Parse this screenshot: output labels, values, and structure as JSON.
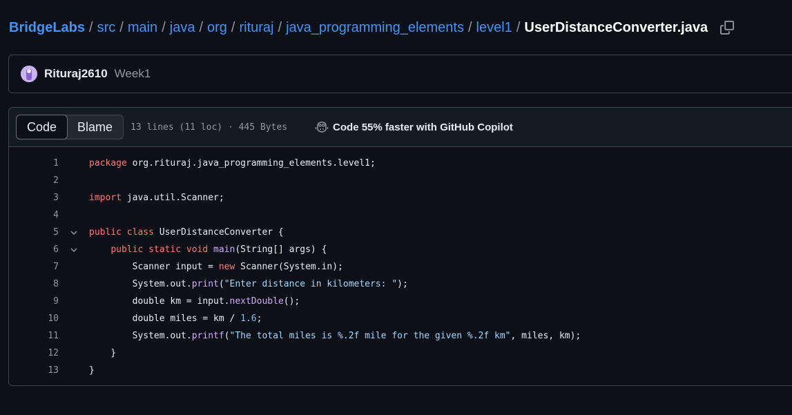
{
  "breadcrumb": {
    "repo": "BridgeLabs",
    "path": [
      "src",
      "main",
      "java",
      "org",
      "rituraj",
      "java_programming_elements",
      "level1"
    ],
    "separator": "/",
    "file": "UserDistanceConverter.java"
  },
  "commit": {
    "author": "Rituraj2610",
    "message": "Week1"
  },
  "file_header": {
    "code_tab": "Code",
    "blame_tab": "Blame",
    "info": "13 lines (11 loc) · 445 Bytes",
    "copilot": "Code 55% faster with GitHub Copilot"
  },
  "code_lines": [
    {
      "n": "1",
      "fold": false,
      "tokens": [
        {
          "t": "kw",
          "v": "package"
        },
        {
          "t": "",
          "v": " org.rituraj.java_programming_elements.level1;"
        }
      ]
    },
    {
      "n": "2",
      "fold": false,
      "tokens": []
    },
    {
      "n": "3",
      "fold": false,
      "tokens": [
        {
          "t": "kw",
          "v": "import"
        },
        {
          "t": "",
          "v": " java.util.Scanner;"
        }
      ]
    },
    {
      "n": "4",
      "fold": false,
      "tokens": []
    },
    {
      "n": "5",
      "fold": true,
      "tokens": [
        {
          "t": "kw",
          "v": "public class"
        },
        {
          "t": "",
          "v": " UserDistanceConverter {"
        }
      ]
    },
    {
      "n": "6",
      "fold": true,
      "tokens": [
        {
          "t": "",
          "v": "    "
        },
        {
          "t": "kw",
          "v": "public static void"
        },
        {
          "t": "",
          "v": " "
        },
        {
          "t": "fn",
          "v": "main"
        },
        {
          "t": "",
          "v": "(String[] args) {"
        }
      ]
    },
    {
      "n": "7",
      "fold": false,
      "tokens": [
        {
          "t": "",
          "v": "        Scanner input = "
        },
        {
          "t": "kw",
          "v": "new"
        },
        {
          "t": "",
          "v": " Scanner(System.in);"
        }
      ]
    },
    {
      "n": "8",
      "fold": false,
      "tokens": [
        {
          "t": "",
          "v": "        System.out."
        },
        {
          "t": "fn",
          "v": "print"
        },
        {
          "t": "",
          "v": "("
        },
        {
          "t": "str",
          "v": "\"Enter distance in kilometers: \""
        },
        {
          "t": "",
          "v": ");"
        }
      ]
    },
    {
      "n": "9",
      "fold": false,
      "tokens": [
        {
          "t": "",
          "v": "        double km = input."
        },
        {
          "t": "fn",
          "v": "nextDouble"
        },
        {
          "t": "",
          "v": "();"
        }
      ]
    },
    {
      "n": "10",
      "fold": false,
      "tokens": [
        {
          "t": "",
          "v": "        double miles = km / "
        },
        {
          "t": "num",
          "v": "1.6"
        },
        {
          "t": "",
          "v": ";"
        }
      ]
    },
    {
      "n": "11",
      "fold": false,
      "tokens": [
        {
          "t": "",
          "v": "        System.out."
        },
        {
          "t": "fn",
          "v": "printf"
        },
        {
          "t": "",
          "v": "("
        },
        {
          "t": "str",
          "v": "\"The total miles is %.2f mile for the given %.2f km\""
        },
        {
          "t": "",
          "v": ", miles, km);"
        }
      ]
    },
    {
      "n": "12",
      "fold": false,
      "tokens": [
        {
          "t": "",
          "v": "    }"
        }
      ]
    },
    {
      "n": "13",
      "fold": false,
      "tokens": [
        {
          "t": "",
          "v": "}"
        }
      ]
    }
  ],
  "colors": {
    "link": "#4493f8",
    "keyword": "#ff7b72",
    "function": "#d2a8ff",
    "string": "#a5d6ff",
    "number": "#79c0ff"
  },
  "icons": {
    "copy": "copy-icon",
    "avatar": "avatar",
    "copilot": "copilot-icon",
    "fold": "chevron-down-icon"
  }
}
